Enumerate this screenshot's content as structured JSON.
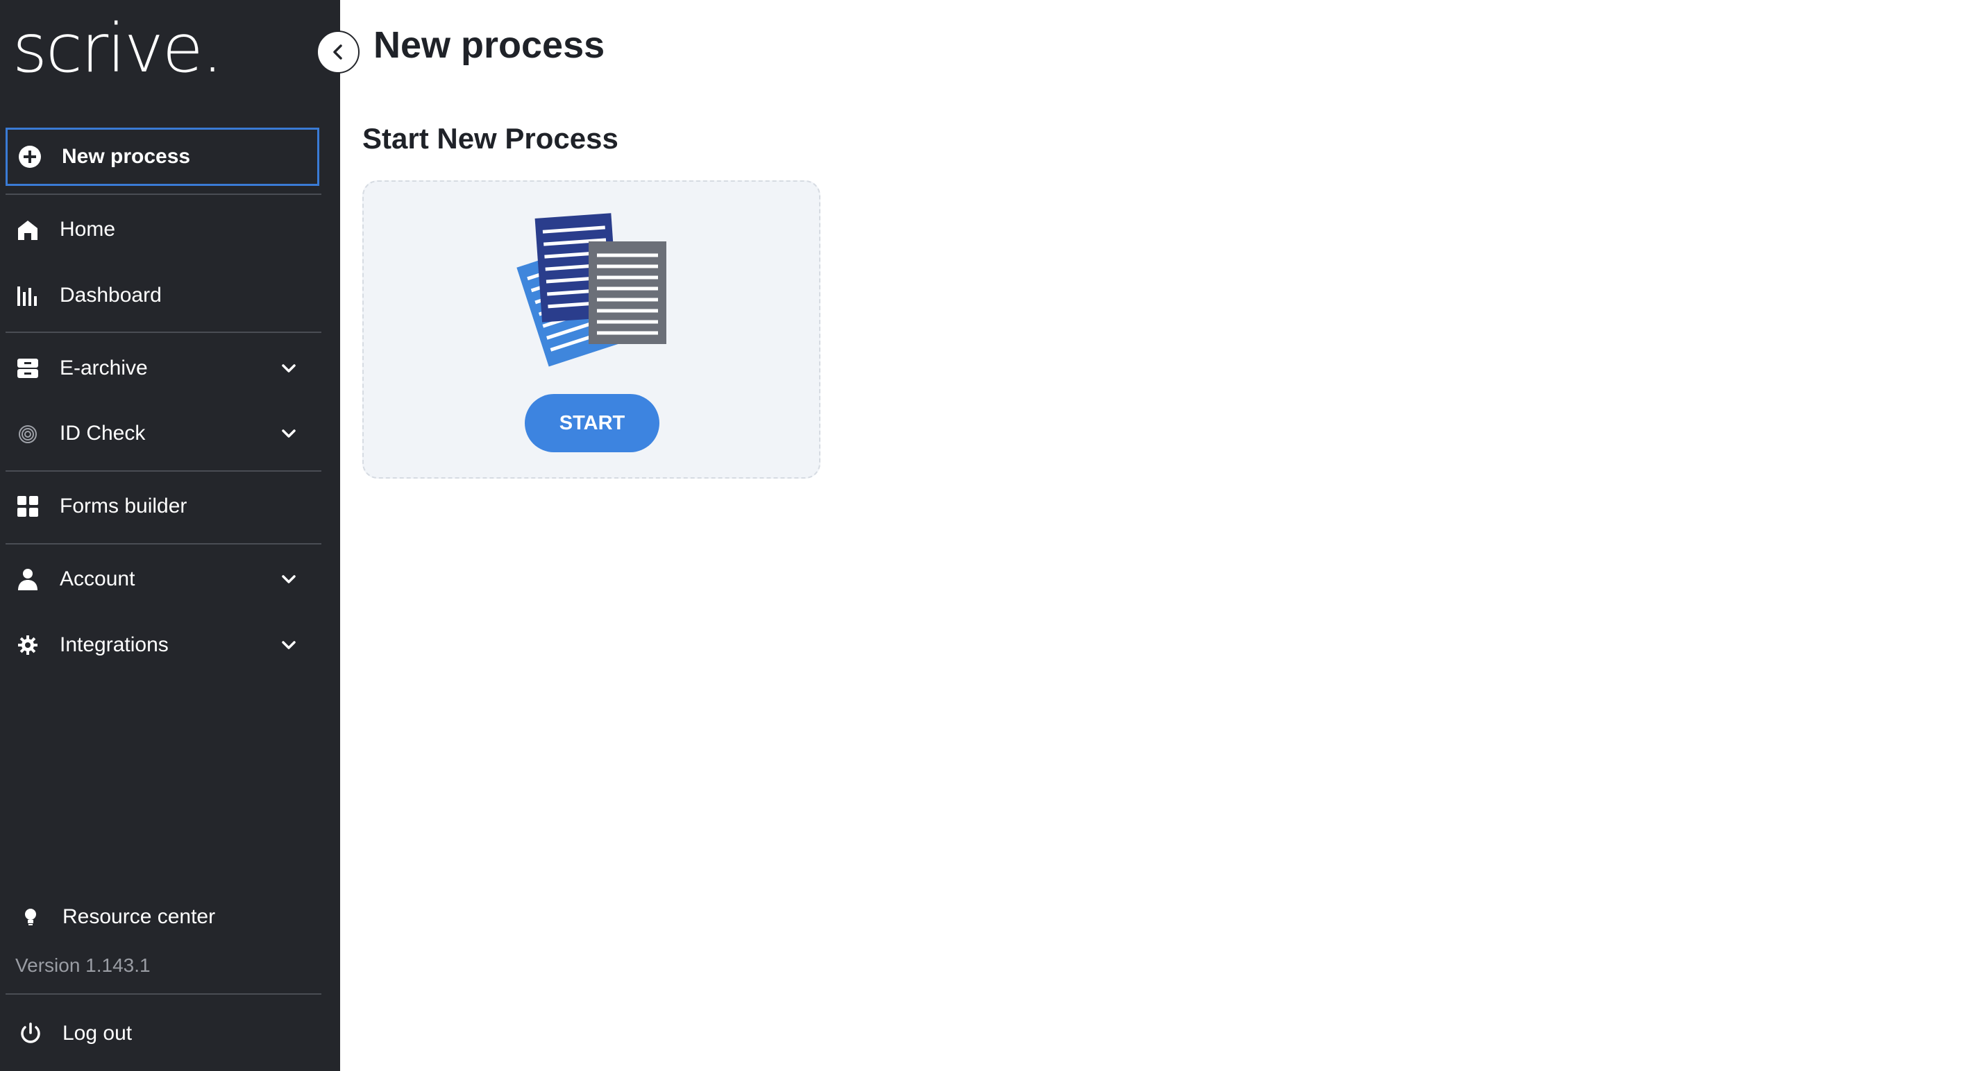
{
  "brand": {
    "logo_text": "scrive."
  },
  "header": {
    "title": "New process"
  },
  "sidebar": {
    "primary": {
      "label": "New process",
      "icon": "plus-circle-icon"
    },
    "items": [
      {
        "label": "Home",
        "icon": "home-icon"
      },
      {
        "label": "Dashboard",
        "icon": "bar-chart-icon"
      },
      {
        "label": "E-archive",
        "icon": "archive-icon",
        "expandable": true
      },
      {
        "label": "ID Check",
        "icon": "fingerprint-icon",
        "expandable": true
      },
      {
        "label": "Forms builder",
        "icon": "grid-icon"
      },
      {
        "label": "Account",
        "icon": "user-icon",
        "expandable": true
      },
      {
        "label": "Integrations",
        "icon": "gear-icon",
        "expandable": true
      }
    ],
    "resource_center": {
      "label": "Resource center",
      "icon": "lightbulb-icon"
    },
    "version": "Version 1.143.1",
    "logout": {
      "label": "Log out",
      "icon": "power-icon"
    }
  },
  "main": {
    "section_title": "Start New Process",
    "card": {
      "button_label": "START"
    }
  },
  "colors": {
    "sidebar_bg": "#24262b",
    "accent": "#3d84e0",
    "active_border": "#3a7bd5",
    "card_bg": "#f1f4f8"
  }
}
